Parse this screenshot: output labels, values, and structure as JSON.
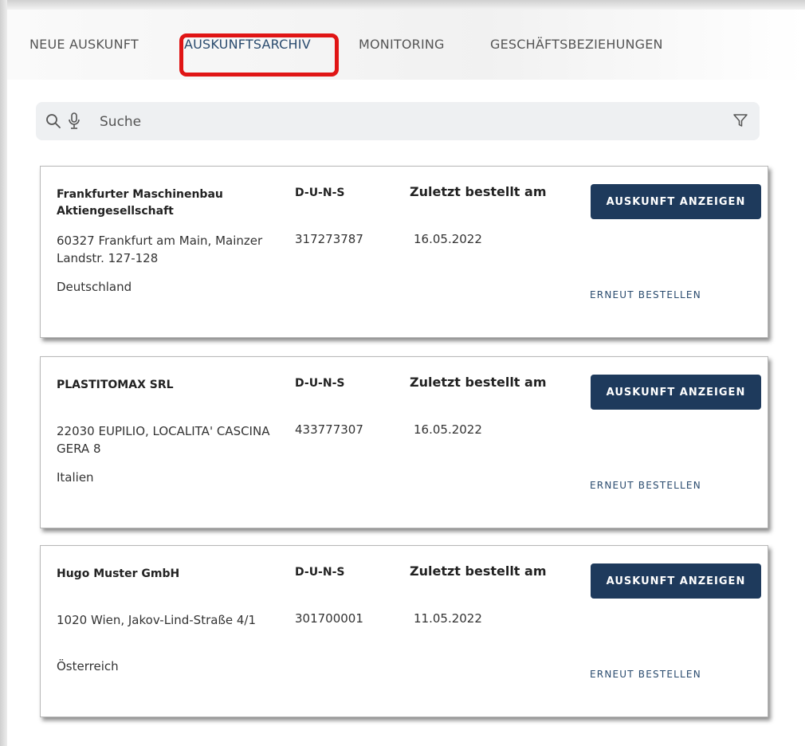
{
  "tabs": [
    {
      "label": "NEUE AUSKUNFT"
    },
    {
      "label": "AUSKUNFTSARCHIV",
      "active": true
    },
    {
      "label": "MONITORING"
    },
    {
      "label": "GESCHÄFTSBEZIEHUNGEN"
    }
  ],
  "search": {
    "placeholder": "Suche"
  },
  "columns": {
    "duns": "D-U-N-S",
    "date": "Zuletzt bestellt am"
  },
  "buttons": {
    "show": "AUSKUNFT ANZEIGEN",
    "reorder": "ERNEUT BESTELLEN"
  },
  "records": [
    {
      "name": "Frankfurter Maschinenbau Aktiengesellschaft",
      "address": "60327 Frankfurt am Main, Mainzer Landstr. 127-128",
      "country": "Deutschland",
      "duns": "317273787",
      "date": "16.05.2022"
    },
    {
      "name": "PLASTITOMAX SRL",
      "address": "22030 EUPILIO, LOCALITA' CASCINA GERA 8",
      "country": "Italien",
      "duns": "433777307",
      "date": "16.05.2022"
    },
    {
      "name": "Hugo Muster GmbH",
      "address": "1020 Wien, Jakov-Lind-Straße 4/1",
      "country": "Österreich",
      "duns": "301700001",
      "date": "11.05.2022"
    }
  ],
  "colors": {
    "primary": "#1e3a5c",
    "highlight": "#e01515",
    "search_bg": "#eef0f2"
  },
  "icons": {
    "search": "search-icon",
    "mic": "microphone-icon",
    "filter": "filter-icon"
  }
}
